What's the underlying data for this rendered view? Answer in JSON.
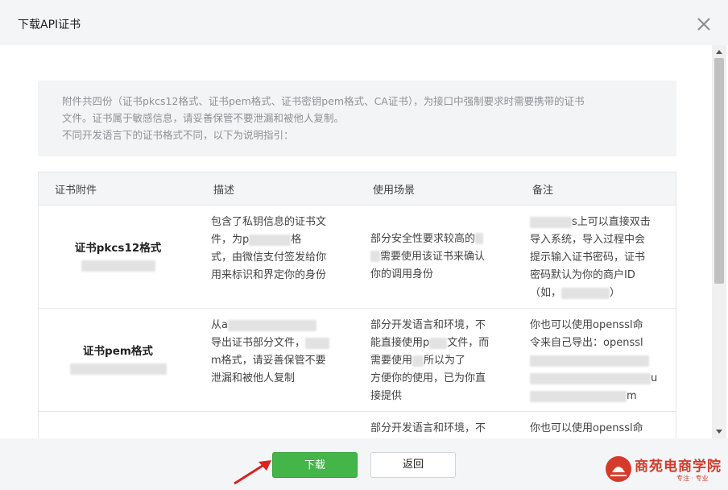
{
  "dialog": {
    "title": "下载API证书",
    "notice": [
      "附件共四份（证书pkcs12格式、证书pem格式、证书密钥pem格式、CA证书），为接口中强制要求时需要携带的证书",
      "文件。证书属于敏感信息，请妥善保管不要泄漏和被他人复制。",
      "不同开发语言下的证书格式不同，以下为说明指引："
    ],
    "table": {
      "headers": [
        "证书附件",
        "描述",
        "使用场景",
        "备注"
      ],
      "rows": [
        {
          "name": "证书pkcs12格式",
          "desc": [
            "包含了私钥信息的证书文",
            "件，为p",
            "式，由微信支付签发给你",
            "用来标识和界定你的身份"
          ],
          "desc_tail": "格",
          "usage": [
            "部分安全性要求较高的",
            "需要使用该证书来确认",
            "你的调用身份"
          ],
          "note": [
            "s上可以直接双击",
            "导入系统，导入过程中会",
            "提示输入证书密码，证书",
            "密码默认为你的商户ID",
            "（如，",
            "）"
          ]
        },
        {
          "name": "证书pem格式",
          "desc": [
            "从a",
            "导出证书部分文件，",
            "m格式，请妥善保管不要",
            "泄漏和被他人复制"
          ],
          "usage": [
            "部分开发语言和环境，不",
            "能直接使用p",
            "文件，而",
            "需要使用",
            "所以为了",
            "方便你的使用，已为你直",
            "接提供"
          ],
          "note": [
            "你也可以使用openssl命",
            "令来自己导出：openssl",
            "u",
            "m"
          ]
        },
        {
          "usage": [
            "部分开发语言和环境，不"
          ],
          "note": [
            "你也可以使用openssl命"
          ]
        }
      ]
    },
    "buttons": {
      "download": "下载",
      "back": "返回"
    }
  },
  "watermark": {
    "name": "商苑电商学院",
    "tagline": "专注 · 专业"
  }
}
